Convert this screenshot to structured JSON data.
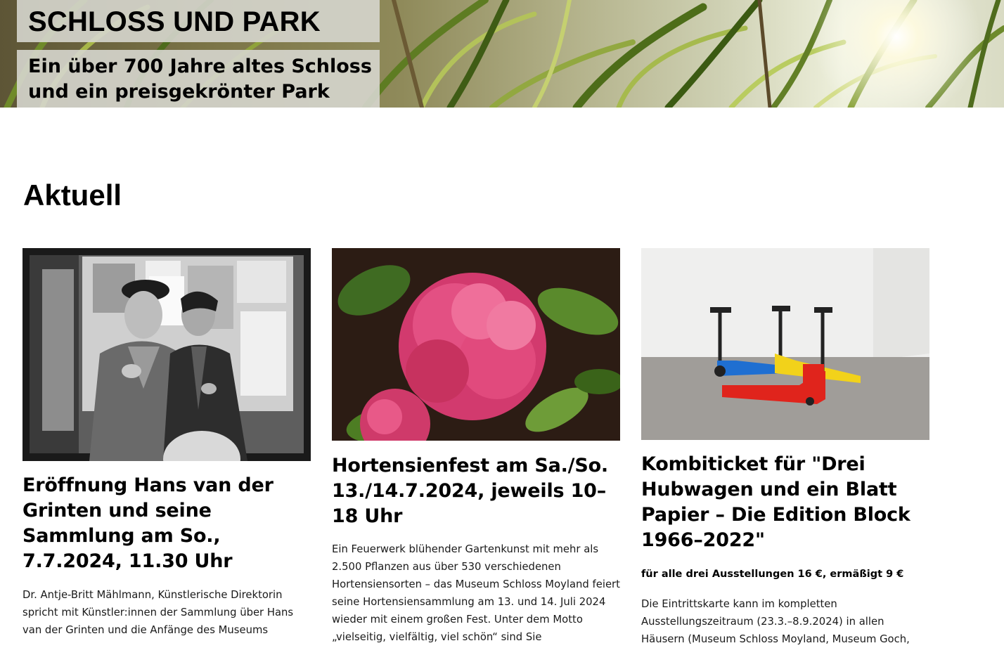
{
  "hero": {
    "title": "SCHLOSS UND PARK",
    "subtitle": "Ein über 700 Jahre altes Schloss und ein preisgekrönter Park"
  },
  "section": {
    "title": "Aktuell"
  },
  "cards": [
    {
      "title": "Eröffnung Hans van der Grinten und seine Sammlung am So., 7.7.2024, 11.30 Uhr",
      "text": "Dr. Antje-Britt Mählmann, Künstlerische Direktorin spricht mit Künstler:innen der Sammlung über Hans van der Grinten und die Anfänge des Museums"
    },
    {
      "title": "Hortensienfest am Sa./So. 13./14.7.2024, jeweils 10–18 Uhr",
      "text": "Ein Feuerwerk blühender Gartenkunst mit mehr als 2.500 Pflanzen aus über 530 verschiedenen Hortensiensorten – das Museum Schloss Moyland feiert seine Hortensiensammlung am 13. und 14. Juli 2024 wieder mit einem großen Fest. Unter dem Motto „vielseitig, vielfältig, viel schön“ sind Sie"
    },
    {
      "title": "Kombiticket für \"Drei Hubwagen und ein Blatt Papier – Die Edition Block 1966–2022\"",
      "lead": "für alle drei Ausstellungen 16 €, ermäßigt 9 €",
      "text": "Die Eintrittskarte kann im kompletten Ausstellungszeitraum (23.3.–8.9.2024) in allen Häusern (Museum Schloss Moyland, Museum Goch,"
    }
  ],
  "colors": {
    "background": "#ffffff",
    "text": "#111111",
    "hero_overlay": "#d6d6ce",
    "pallet_blue": "#1f6fd1",
    "pallet_yellow": "#f2d21a",
    "pallet_red": "#e0241c",
    "flower_pink": "#e2417a"
  },
  "images": {
    "hero": "sunlit-reeds-photo",
    "card_1": "black-and-white-photo-two-men",
    "card_2": "pink-hydrangea-photo",
    "card_3": "three-pallet-trucks-photo"
  }
}
